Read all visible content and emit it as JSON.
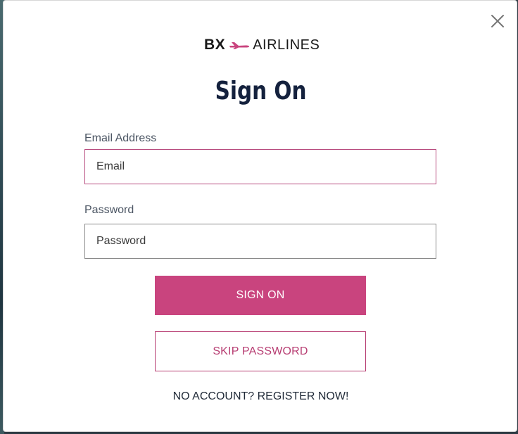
{
  "modal": {
    "logo": {
      "brand": "BX",
      "name": "AIRLINES",
      "accent_color": "#c9447e"
    },
    "title": "Sign On",
    "close_icon": "close-icon",
    "email": {
      "label": "Email Address",
      "placeholder": "Email",
      "value": ""
    },
    "password": {
      "label": "Password",
      "placeholder": "Password",
      "value": ""
    },
    "sign_on_button": "SIGN ON",
    "skip_password_button": "SKIP PASSWORD",
    "register_link": "NO ACCOUNT? REGISTER NOW!"
  },
  "colors": {
    "primary": "#c9447e",
    "title": "#14213d",
    "focus_border": "#b84b7f"
  }
}
